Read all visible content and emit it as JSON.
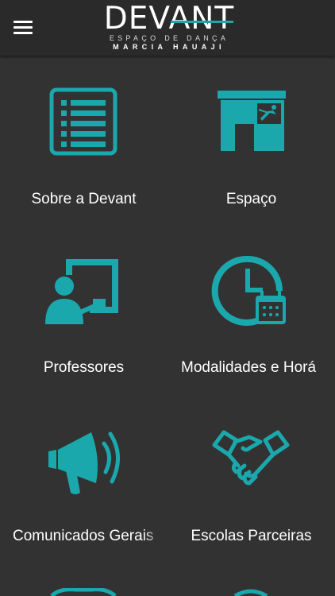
{
  "header": {
    "logo_main": "DEVANT",
    "logo_sub": "ESPAÇO DE DANÇA",
    "logo_sub2": "MARCIA HAUAJI"
  },
  "colors": {
    "accent": "#1aa8ad",
    "background": "#333232",
    "header": "#2b2a2a"
  },
  "menu": {
    "items": [
      {
        "label": "Sobre a Devant",
        "icon": "list-document-icon"
      },
      {
        "label": "Espaço",
        "icon": "dance-studio-icon"
      },
      {
        "label": "Professores",
        "icon": "teacher-board-icon"
      },
      {
        "label": "Modalidades e Horá",
        "icon": "clock-calendar-icon"
      },
      {
        "label": "Comunicados Gerais",
        "icon": "megaphone-icon"
      },
      {
        "label": "Escolas Parceiras",
        "icon": "handshake-icon"
      }
    ]
  }
}
